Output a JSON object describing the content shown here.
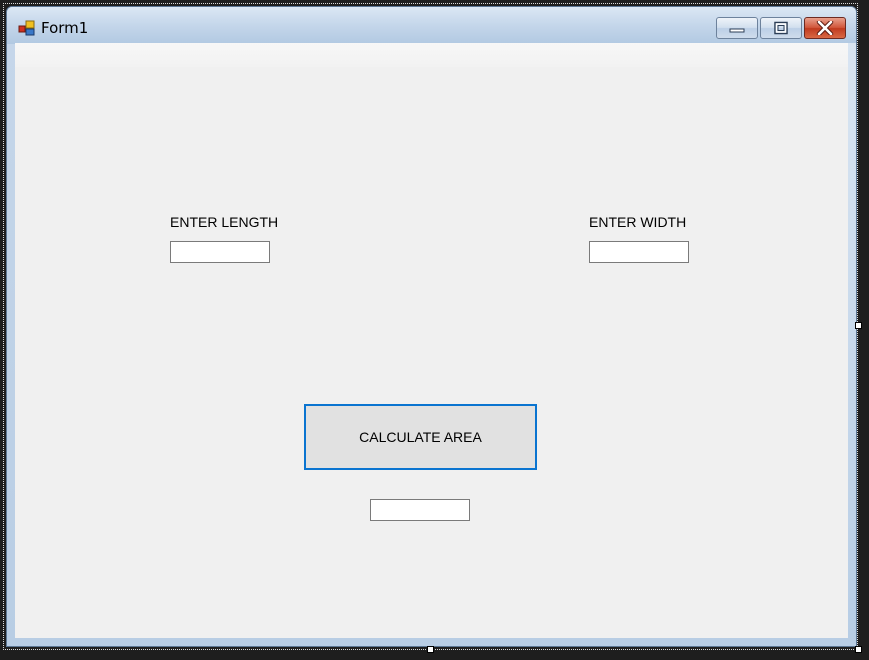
{
  "window": {
    "title": "Form1",
    "icon": "form-app-icon",
    "controls": {
      "minimize": "minimize-icon",
      "maximize": "maximize-icon",
      "close": "close-icon"
    }
  },
  "form": {
    "length_label": "ENTER LENGTH",
    "width_label": "ENTER WIDTH",
    "length_value": "",
    "width_value": "",
    "calculate_button_label": "CALCULATE AREA",
    "result_value": ""
  },
  "colors": {
    "button_focus_border": "#0a74d0",
    "client_background": "#f0f0f0",
    "close_button": "#c94a2d"
  }
}
